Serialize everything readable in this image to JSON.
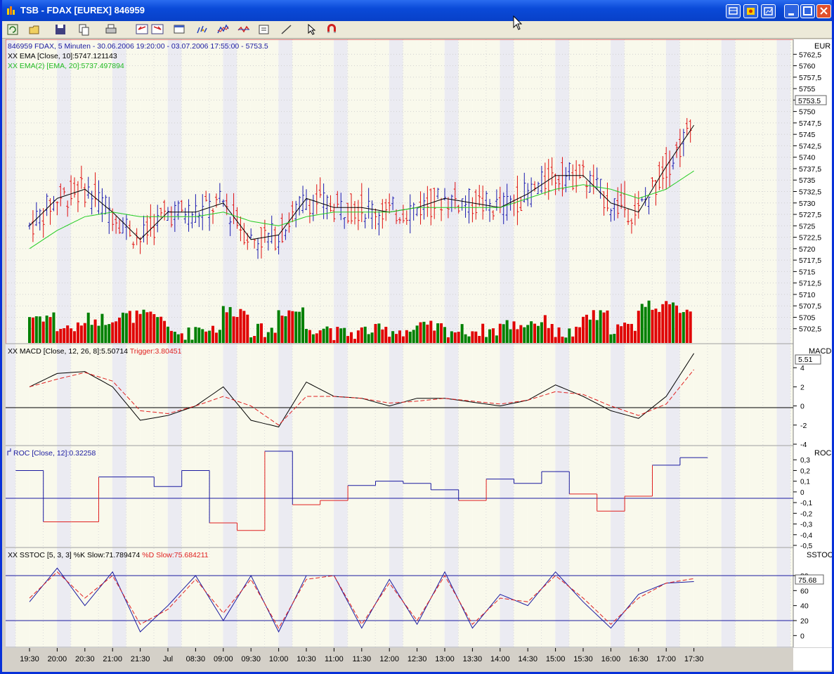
{
  "window": {
    "title": "TSB - FDAX [EUREX] 846959"
  },
  "price_panel": {
    "header": "846959  FDAX, 5 Minuten - 30.06.2006 19:20:00 - 03.07.2006 17:55:00 - 5753.5",
    "ema1_label": "XX EMA [Close, 10]:5747.121143",
    "ema2_label": "XX EMA(2) [EMA, 20]:5737.497894",
    "currency": "EUR",
    "last_price": "5753.5",
    "y_ticks": [
      "5762,5",
      "5760",
      "5757,5",
      "5755",
      "5752,5",
      "5750",
      "5747,5",
      "5745",
      "5742,5",
      "5740",
      "5737,5",
      "5735",
      "5732,5",
      "5730",
      "5727,5",
      "5725",
      "5722,5",
      "5720",
      "5717,5",
      "5715",
      "5712,5",
      "5710",
      "5707,5",
      "5705",
      "5702,5"
    ]
  },
  "macd_panel": {
    "label": "XX MACD [Close, 12, 26, 8]:5.50714",
    "trigger_label": "Trigger:3.80451",
    "name": "MACD",
    "last_value": "5.51",
    "y_ticks": [
      "4",
      "2",
      "0",
      "-2",
      "-4"
    ]
  },
  "roc_panel": {
    "label": "ROC [Close, 12]:0.32258",
    "name": "ROC",
    "y_ticks": [
      "0,3",
      "0,2",
      "0,1",
      "0",
      "-0,1",
      "-0,2",
      "-0,3",
      "-0,4",
      "-0,5"
    ]
  },
  "sstoc_panel": {
    "label": "XX SSTOC [5, 3, 3] %K Slow:71.789474",
    "d_label": "%D Slow:75.684211",
    "name": "SSTOC",
    "last_value": "75.68",
    "y_ticks": [
      "80",
      "60",
      "40",
      "20",
      "0"
    ]
  },
  "time_axis": [
    "19:30",
    "20:00",
    "20:30",
    "21:00",
    "21:30",
    "Jul",
    "08:30",
    "09:00",
    "09:30",
    "10:00",
    "10:30",
    "11:00",
    "11:30",
    "12:00",
    "12:30",
    "13:00",
    "13:30",
    "14:00",
    "14:30",
    "15:00",
    "15:30",
    "16:00",
    "16:30",
    "17:00",
    "17:30"
  ],
  "colors": {
    "up": "#1a1ab0",
    "down": "#e01010",
    "ema1": "#000000",
    "ema2": "#22cc22",
    "vol_up": "#008000",
    "vol_down": "#e00000",
    "band_light": "#f9f9ec",
    "band_dark": "#ebebf2"
  },
  "chart_data": [
    {
      "type": "bar",
      "title": "846959  FDAX, 5 Minuten - 30.06.2006 19:20:00 - 03.07.2006 17:55:00 - 5753.5",
      "ylim": [
        5700,
        5765
      ],
      "x": [
        "19:30",
        "20:00",
        "20:30",
        "21:00",
        "21:30",
        "Jul",
        "08:30",
        "09:00",
        "09:30",
        "10:00",
        "10:30",
        "11:00",
        "11:30",
        "12:00",
        "12:30",
        "13:00",
        "13:30",
        "14:00",
        "14:30",
        "15:00",
        "15:30",
        "16:00",
        "16:30",
        "17:00",
        "17:30"
      ],
      "series": [
        {
          "name": "XX EMA [Close, 10]",
          "values": [
            5725,
            5731,
            5733,
            5728,
            5722,
            5728,
            5728,
            5730,
            5722,
            5723,
            5731,
            5729,
            5729,
            5728,
            5729,
            5731,
            5730,
            5729,
            5732,
            5736,
            5736,
            5730,
            5728,
            5738,
            5747
          ]
        },
        {
          "name": "XX EMA(2) [EMA, 20]",
          "values": [
            5720,
            5724,
            5727,
            5728,
            5727,
            5727,
            5727,
            5728,
            5726,
            5725,
            5727,
            5728,
            5728,
            5728,
            5729,
            5729,
            5729,
            5729,
            5731,
            5733,
            5734,
            5733,
            5731,
            5733,
            5737
          ]
        }
      ]
    },
    {
      "type": "line",
      "title": "XX MACD [Close, 12, 26, 8]",
      "ylim": [
        -4,
        6
      ],
      "x": [
        "19:30",
        "20:00",
        "20:30",
        "21:00",
        "21:30",
        "Jul",
        "08:30",
        "09:00",
        "09:30",
        "10:00",
        "10:30",
        "11:00",
        "11:30",
        "12:00",
        "12:30",
        "13:00",
        "13:30",
        "14:00",
        "14:30",
        "15:00",
        "15:30",
        "16:00",
        "16:30",
        "17:00",
        "17:30"
      ],
      "series": [
        {
          "name": "MACD",
          "values": [
            2,
            3.4,
            3.6,
            2,
            -1.5,
            -1,
            0,
            2,
            -1.5,
            -2.2,
            2.5,
            1,
            0.8,
            0,
            0.8,
            0.8,
            0.4,
            0,
            0.6,
            2.2,
            1,
            -0.5,
            -1.3,
            1,
            5.5
          ]
        },
        {
          "name": "Trigger",
          "values": [
            2,
            2.8,
            3.5,
            2.6,
            -0.5,
            -0.8,
            0,
            1,
            0,
            -2,
            1,
            1,
            0.8,
            0.3,
            0.5,
            0.8,
            0.5,
            0.2,
            0.6,
            1.5,
            1.2,
            0,
            -1,
            0.2,
            3.8
          ]
        }
      ]
    },
    {
      "type": "line",
      "title": "ROC [Close, 12]",
      "ylim": [
        -0.5,
        0.4
      ],
      "x": [
        "19:30",
        "20:00",
        "20:30",
        "21:00",
        "21:30",
        "Jul",
        "08:30",
        "09:00",
        "09:30",
        "10:00",
        "10:30",
        "11:00",
        "11:30",
        "12:00",
        "12:30",
        "13:00",
        "13:30",
        "14:00",
        "14:30",
        "15:00",
        "15:30",
        "16:00",
        "16:30",
        "17:00",
        "17:30"
      ],
      "series": [
        {
          "name": "ROC",
          "values": [
            0.2,
            -0.28,
            -0.28,
            0.14,
            0.14,
            0.05,
            0.2,
            -0.29,
            -0.36,
            0.38,
            -0.12,
            -0.08,
            0.06,
            0.1,
            0.08,
            0.02,
            -0.08,
            0.12,
            0.08,
            0.19,
            -0.02,
            -0.18,
            -0.04,
            0.25,
            0.32
          ]
        }
      ]
    },
    {
      "type": "line",
      "title": "XX SSTOC [5, 3, 3]",
      "ylim": [
        -10,
        100
      ],
      "x": [
        "19:30",
        "20:00",
        "20:30",
        "21:00",
        "21:30",
        "Jul",
        "08:30",
        "09:00",
        "09:30",
        "10:00",
        "10:30",
        "11:00",
        "11:30",
        "12:00",
        "12:30",
        "13:00",
        "13:30",
        "14:00",
        "14:30",
        "15:00",
        "15:30",
        "16:00",
        "16:30",
        "17:00",
        "17:30"
      ],
      "series": [
        {
          "name": "%K Slow",
          "values": [
            45,
            90,
            40,
            85,
            5,
            40,
            80,
            20,
            80,
            5,
            80,
            80,
            10,
            75,
            15,
            85,
            10,
            55,
            40,
            85,
            45,
            10,
            55,
            70,
            72
          ]
        },
        {
          "name": "%D Slow",
          "values": [
            50,
            85,
            50,
            80,
            15,
            35,
            75,
            30,
            75,
            10,
            75,
            80,
            15,
            70,
            20,
            80,
            15,
            50,
            45,
            80,
            50,
            15,
            50,
            70,
            76
          ]
        }
      ]
    }
  ]
}
